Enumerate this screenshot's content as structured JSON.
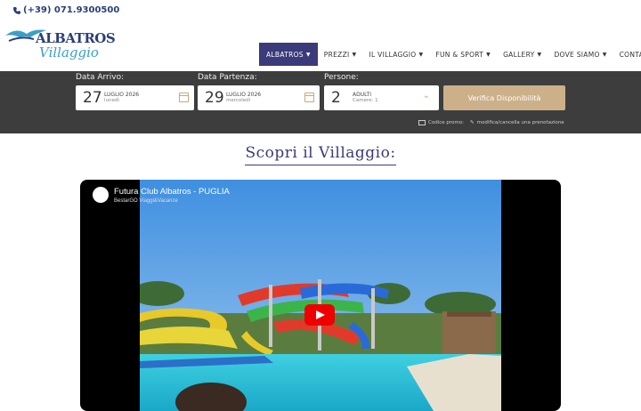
{
  "header": {
    "phone": "(+39) 071.9300500",
    "logo_text": "ALBATROS",
    "logo_script": "Villaggio"
  },
  "nav": {
    "items": [
      {
        "label": "ALBATROS",
        "active": true
      },
      {
        "label": "PREZZI"
      },
      {
        "label": "IL VILLAGGIO"
      },
      {
        "label": "FUN & SPORT"
      },
      {
        "label": "GALLERY"
      },
      {
        "label": "DOVE SIAMO"
      },
      {
        "label": "CONTATTI"
      }
    ]
  },
  "booking": {
    "arrival": {
      "label": "Data Arrivo:",
      "day": "27",
      "month": "LUGLIO 2026",
      "weekday": "lunedì"
    },
    "departure": {
      "label": "Data Partenza:",
      "day": "29",
      "month": "LUGLIO 2026",
      "weekday": "mercoledì"
    },
    "people": {
      "label": "Persone:",
      "count": "2",
      "unit": "ADULTI",
      "rooms": "Camere: 1"
    },
    "verify_label": "Verifica Disponibilità",
    "promo_label": "Codice promo:",
    "modify_label": "modifica/cancella una prenotazione"
  },
  "section": {
    "heading": "Scopri il Villaggio:"
  },
  "video": {
    "title": "Futura Club Albatros - PUGLIA",
    "channel": "BestarGO Viaggi&Vacanze"
  },
  "colors": {
    "brand": "#3b3a7a",
    "accent": "#cbb08a",
    "bar": "#3d3d3d"
  }
}
